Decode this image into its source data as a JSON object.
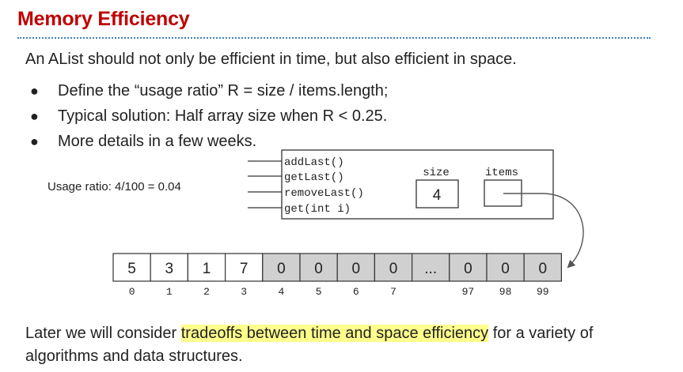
{
  "slide": {
    "title": "Memory Efficiency",
    "intro": "An AList should not only be efficient in time, but also efficient in space.",
    "bullets": [
      "Define the “usage ratio” R = size / items.length;",
      "Typical solution: Half array size when R < 0.25.",
      "More details in a few weeks."
    ],
    "usage_ratio": "Usage ratio: 4/100 = 0.04",
    "outro": {
      "before": "Later we will consider ",
      "highlight": "tradeoffs between time and space efficiency",
      "after": " for a variety of algorithms and data structures."
    },
    "colors": {
      "title": "#c00000",
      "divider": "#3d7fc0",
      "highlight": "#ffff8c",
      "unused_cell": "#d0d0d0"
    }
  },
  "alist": {
    "methods": [
      "addLast()",
      "getLast()",
      "removeLast()",
      "get(int i)"
    ],
    "size_label": "size",
    "size_value": "4",
    "items_label": "items"
  },
  "array": {
    "cells": [
      "5",
      "3",
      "1",
      "7",
      "0",
      "0",
      "0",
      "0",
      "...",
      "0",
      "0",
      "0"
    ],
    "indices": [
      "0",
      "1",
      "2",
      "3",
      "4",
      "5",
      "6",
      "7",
      "",
      "97",
      "98",
      "99"
    ],
    "used_count": 4
  }
}
